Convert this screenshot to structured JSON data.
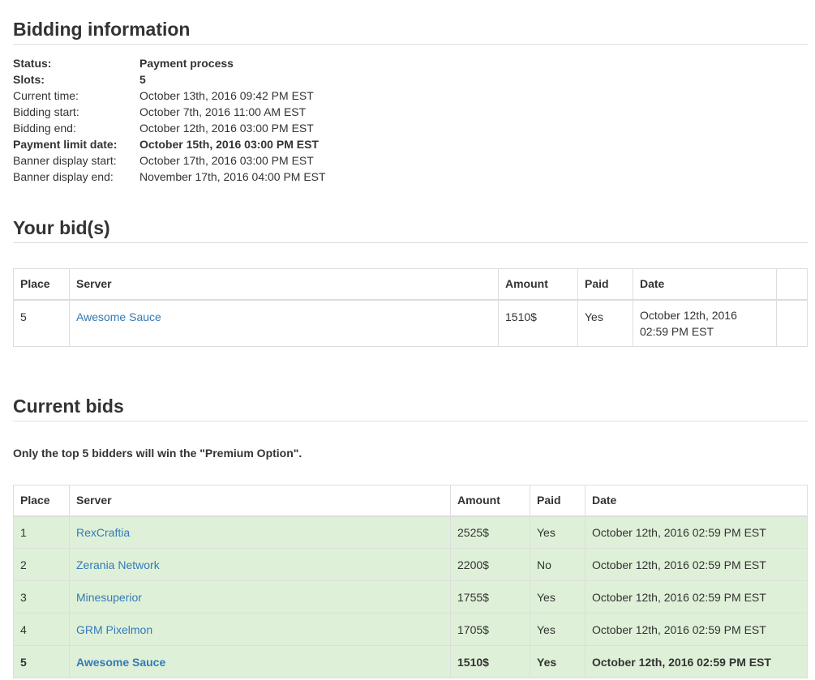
{
  "bidding_info": {
    "heading": "Bidding information",
    "rows": [
      {
        "label": "Status:",
        "value": "Payment process"
      },
      {
        "label": "Slots:",
        "value": "5"
      },
      {
        "label": "Current time:",
        "value": "October 13th, 2016 09:42 PM EST"
      },
      {
        "label": "Bidding start:",
        "value": "October 7th, 2016 11:00 AM EST"
      },
      {
        "label": "Bidding end:",
        "value": "October 12th, 2016 03:00 PM EST"
      },
      {
        "label": "Payment limit date:",
        "value": "October 15th, 2016 03:00 PM EST"
      },
      {
        "label": "Banner display start:",
        "value": "October 17th, 2016 03:00 PM EST"
      },
      {
        "label": "Banner display end:",
        "value": "November 17th, 2016 04:00 PM EST"
      }
    ]
  },
  "your_bids": {
    "heading": "Your bid(s)",
    "columns": [
      "Place",
      "Server",
      "Amount",
      "Paid",
      "Date",
      ""
    ],
    "rows": [
      {
        "place": "5",
        "server": "Awesome Sauce",
        "amount": "1510$",
        "paid": "Yes",
        "date_line1": "October 12th, 2016",
        "date_line2": "02:59 PM EST"
      }
    ]
  },
  "current_bids": {
    "heading": "Current bids",
    "note": "Only the top 5 bidders will win the \"Premium Option\".",
    "columns": [
      "Place",
      "Server",
      "Amount",
      "Paid",
      "Date"
    ],
    "rows": [
      {
        "place": "1",
        "server": "RexCraftia",
        "amount": "2525$",
        "paid": "Yes",
        "date": "October 12th, 2016 02:59 PM EST"
      },
      {
        "place": "2",
        "server": "Zerania Network",
        "amount": "2200$",
        "paid": "No",
        "date": "October 12th, 2016 02:59 PM EST"
      },
      {
        "place": "3",
        "server": "Minesuperior",
        "amount": "1755$",
        "paid": "Yes",
        "date": "October 12th, 2016 02:59 PM EST"
      },
      {
        "place": "4",
        "server": "GRM Pixelmon",
        "amount": "1705$",
        "paid": "Yes",
        "date": "October 12th, 2016 02:59 PM EST"
      },
      {
        "place": "5",
        "server": "Awesome Sauce",
        "amount": "1510$",
        "paid": "Yes",
        "date": "October 12th, 2016 02:59 PM EST"
      }
    ]
  },
  "colors": {
    "link": "#337ab7",
    "winner_row_bg": "#dff0d8",
    "border": "#dddddd",
    "text": "#333333"
  }
}
